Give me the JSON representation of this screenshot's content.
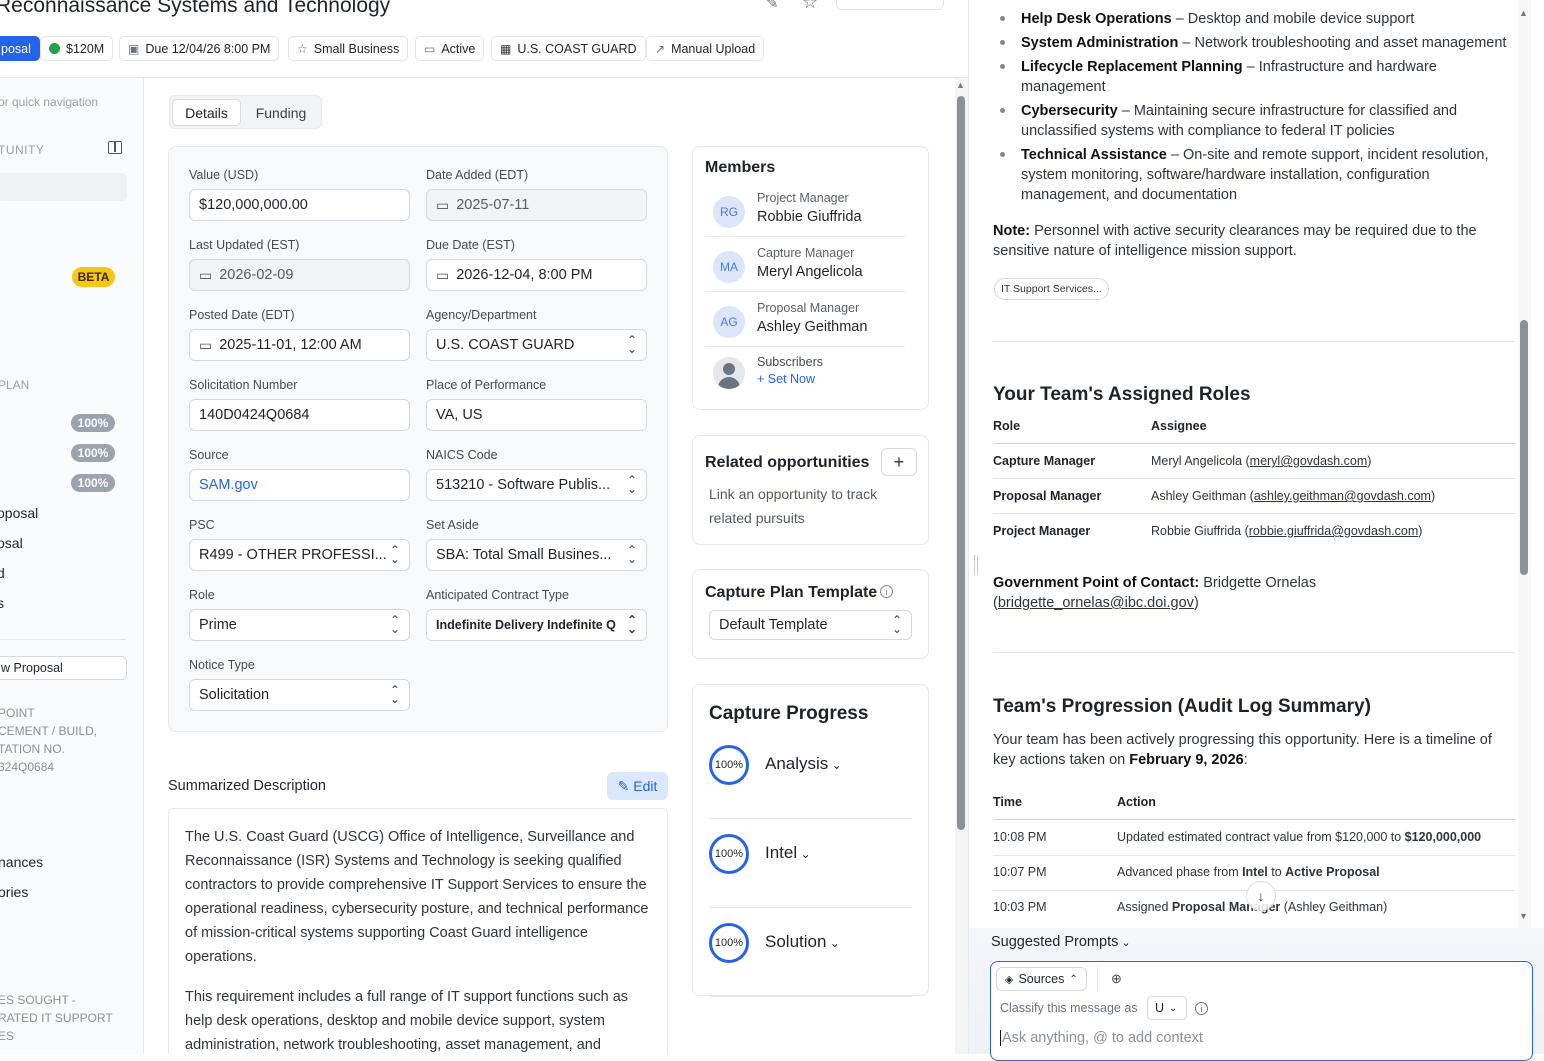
{
  "header": {
    "title": "Reconnaissance Systems and Technology",
    "chips": {
      "phase": "posal",
      "value": "$120M",
      "due": "Due 12/04/26 8:00 PM",
      "set_aside": "Small Business",
      "status": "Active",
      "agency": "U.S. COAST GUARD",
      "source": "Manual Upload"
    }
  },
  "sidebar": {
    "search_placeholder": "or quick navigation",
    "section_opportunity": "TUNITY",
    "beta": "BETA",
    "section_plan": "PLAN",
    "progress": [
      "100%",
      "100%",
      "100%"
    ],
    "items": [
      "oposal",
      "osal",
      "d",
      "s"
    ],
    "new_proposal": "w Proposal",
    "context_1": [
      "POINT",
      "CEMENT / BUILD,",
      "TATION NO.",
      "324Q0684"
    ],
    "items2": [
      "nances",
      "ories"
    ],
    "context_2": [
      "ES SOUGHT -",
      "RATED IT SUPPORT",
      "ES"
    ]
  },
  "tabs": {
    "details": "Details",
    "funding": "Funding"
  },
  "form": {
    "value_label": "Value (USD)",
    "value": "$120,000,000.00",
    "date_added_label": "Date Added (EDT)",
    "date_added": "2025-07-11",
    "last_updated_label": "Last Updated (EST)",
    "last_updated": "2026-02-09",
    "due_date_label": "Due Date (EST)",
    "due_date": "2026-12-04, 8:00 PM",
    "posted_date_label": "Posted Date (EDT)",
    "posted_date": "2025-11-01, 12:00 AM",
    "agency_label": "Agency/Department",
    "agency": "U.S. COAST GUARD",
    "solicitation_label": "Solicitation Number",
    "solicitation": "140D0424Q0684",
    "place_label": "Place of Performance",
    "place": "VA, US",
    "source_label": "Source",
    "source": "SAM.gov",
    "naics_label": "NAICS Code",
    "naics": "513210 - Software Publis...",
    "psc_label": "PSC",
    "psc": "R499 - OTHER PROFESSI...",
    "set_aside_label": "Set Aside",
    "set_aside": "SBA: Total Small Busines...",
    "role_label": "Role",
    "role": "Prime",
    "contract_type_label": "Anticipated Contract Type",
    "contract_type": "Indefinite Delivery Indefinite Q",
    "notice_type_label": "Notice Type",
    "notice_type": "Solicitation"
  },
  "members": {
    "title": "Members",
    "list": [
      {
        "initials": "RG",
        "role": "Project Manager",
        "name": "Robbie Giuffrida"
      },
      {
        "initials": "MA",
        "role": "Capture Manager",
        "name": "Meryl Angelicola"
      },
      {
        "initials": "AG",
        "role": "Proposal Manager",
        "name": "Ashley Geithman"
      }
    ],
    "subscribers_label": "Subscribers",
    "set_now": "Set Now"
  },
  "related": {
    "title": "Related opportunities",
    "text": "Link an opportunity to track related pursuits"
  },
  "template": {
    "title": "Capture Plan Template",
    "value": "Default Template"
  },
  "capture_progress": {
    "title": "Capture Progress",
    "phases": [
      {
        "name": "Analysis",
        "pct": "100%"
      },
      {
        "name": "Intel",
        "pct": "100%"
      },
      {
        "name": "Solution",
        "pct": "100%"
      }
    ]
  },
  "summary": {
    "title": "Summarized Description",
    "edit": "Edit",
    "p1": "The U.S. Coast Guard (USCG) Office of Intelligence, Surveillance and Reconnaissance (ISR) Systems and Technology is seeking qualified contractors to provide comprehensive IT Support Services to ensure the operational readiness, cybersecurity posture, and technical performance of mission-critical systems supporting Coast Guard intelligence operations.",
    "p2": "This requirement includes a full range of IT support functions such as help desk operations, desktop and mobile device support, system administration, network troubleshooting, asset management, and"
  },
  "chat": {
    "bullets": [
      {
        "b": "Help Desk Operations",
        "t": " – Desktop and mobile device support"
      },
      {
        "b": "System Administration",
        "t": " – Network troubleshooting and asset management"
      },
      {
        "b": "Lifecycle Replacement Planning",
        "t": " – Infrastructure and hardware management"
      },
      {
        "b": "Cybersecurity",
        "t": " – Maintaining secure infrastructure for classified and unclassified systems with compliance to federal IT policies"
      },
      {
        "b": "Technical Assistance",
        "t": " – On-site and remote support, incident resolution, system monitoring, software/hardware installation, configuration management, and documentation"
      }
    ],
    "note_label": "Note:",
    "note": " Personnel with active security clearances may be required due to the sensitive nature of intelligence mission support.",
    "source_chip": "IT Support Services...",
    "roles_title": "Your Team's Assigned Roles",
    "roles_headers": [
      "Role",
      "Assignee"
    ],
    "roles": [
      {
        "role": "Capture Manager",
        "name": "Meryl Angelicola (",
        "email": "meryl@govdash.com",
        "close": ")"
      },
      {
        "role": "Proposal Manager",
        "name": "Ashley Geithman (",
        "email": "ashley.geithman@govdash.com",
        "close": ")"
      },
      {
        "role": "Project Manager",
        "name": "Robbie Giuffrida (",
        "email": "robbie.giuffrida@govdash.com",
        "close": ")"
      }
    ],
    "gov_poc_label": "Government Point of Contact:",
    "gov_poc_name": " Bridgette Ornelas",
    "gov_poc_email": "bridgette_ornelas@ibc.doi.gov",
    "progression_title": "Team's Progression (Audit Log Summary)",
    "progression_text": "Your team has been actively progressing this opportunity. Here is a timeline of key actions taken on ",
    "progression_date": "February 9, 2026",
    "log_headers": [
      "Time",
      "Action"
    ],
    "log": [
      {
        "time": "10:08 PM",
        "pre": "Updated estimated contract value from $120,000 to ",
        "b": "$120,000,000",
        "post": ""
      },
      {
        "time": "10:07 PM",
        "pre": "Advanced phase from ",
        "b": "Intel",
        "mid": " to ",
        "b2": "Active Proposal",
        "post": ""
      },
      {
        "time": "10:03 PM",
        "pre": "Assigned ",
        "b": "Proposal Manager",
        "post": " (Ashley Geithman)"
      }
    ],
    "suggested": "Suggested Prompts",
    "sources": "Sources",
    "classify": "Classify this message as",
    "classify_value": "U",
    "input_placeholder": "Ask anything, @ to add context"
  }
}
